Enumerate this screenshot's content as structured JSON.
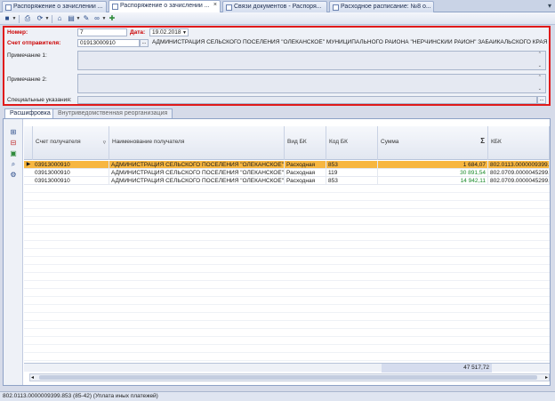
{
  "tabs": [
    {
      "label": "Распоряжение о зачислении ...",
      "active": false
    },
    {
      "label": "Распоряжение о зачислении ...",
      "active": true
    },
    {
      "label": "Связи документов - Распоря...",
      "active": false
    },
    {
      "label": "Расходное расписание: №8 о...",
      "active": false
    }
  ],
  "form": {
    "number_label": "Номер:",
    "number_value": "7",
    "date_label": "Дата:",
    "date_value": "19.02.2018",
    "account_label": "Счет отправителя:",
    "account_value": "01913000910",
    "account_button": "...",
    "account_name": "АДМИНИСТРАЦИЯ  СЕЛЬСКОГО ПОСЕЛЕНИЯ \"ОЛЕКАНСКОЕ\" МУНИЦИПАЛЬНОГО РАЙОНА \"НЕРЧИНСКИЙ РАЙОН\" ЗАБАЙКАЛЬСКОГО КРАЯ",
    "note1_label": "Примечание 1:",
    "note1_value": "",
    "note2_label": "Примечание 2:",
    "note2_value": "",
    "special_label": "Специальные указания:",
    "special_value": ""
  },
  "subtabs": [
    "Расшифровка",
    "Внутриведомственная реорганизация"
  ],
  "grid": {
    "columns": [
      "Счет получателя",
      "Наименование получателя",
      "Вид БК",
      "Код БК",
      "Сумма",
      "КБК"
    ],
    "sum_symbol": "Σ",
    "rows": [
      {
        "account": "03913000910",
        "name": "АДМИНИСТРАЦИЯ СЕЛЬСКОГО ПОСЕЛЕНИЯ \"ОЛЕКАНСКОЕ\"",
        "type": "Расходная",
        "code": "853",
        "sum": "1 684,07",
        "kbk": "802.0113.0000009399.8"
      },
      {
        "account": "03913000910",
        "name": "АДМИНИСТРАЦИЯ СЕЛЬСКОГО ПОСЕЛЕНИЯ \"ОЛЕКАНСКОЕ\"",
        "type": "Расходная",
        "code": "119",
        "sum": "30 891,54",
        "kbk": "802.0709.0000045299.1"
      },
      {
        "account": "03913000910",
        "name": "АДМИНИСТРАЦИЯ СЕЛЬСКОГО ПОСЕЛЕНИЯ \"ОЛЕКАНСКОЕ\"",
        "type": "Расходная",
        "code": "853",
        "sum": "14 942,11",
        "kbk": "802.0709.0000045299.8"
      }
    ],
    "total": "47 517,72"
  },
  "status": "802.0113.0000009399.853 (85-42) (Уплата иных платежей)",
  "colors": {
    "selected_row": "#f7b640",
    "highlight_border": "#e01a1a",
    "positive_sum": "#1a8a2a"
  }
}
